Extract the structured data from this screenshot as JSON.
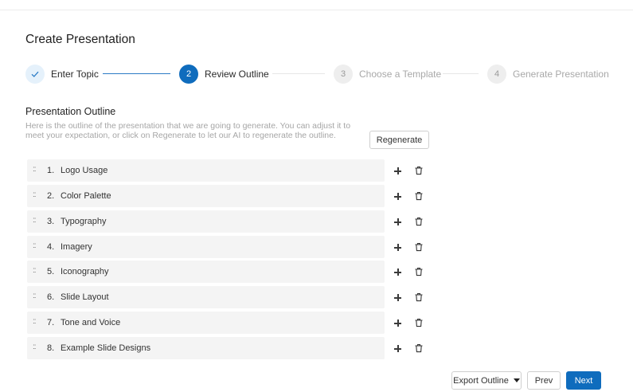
{
  "page": {
    "title": "Create Presentation"
  },
  "stepper": [
    {
      "number": "1",
      "label": "Enter Topic",
      "state": "done"
    },
    {
      "number": "2",
      "label": "Review Outline",
      "state": "active"
    },
    {
      "number": "3",
      "label": "Choose a Template",
      "state": "future"
    },
    {
      "number": "4",
      "label": "Generate Presentation",
      "state": "future"
    }
  ],
  "outline": {
    "title": "Presentation Outline",
    "description": "Here is the outline of the presentation that we are going to generate. You can adjust it to meet your expectation, or click on Regenerate to let our AI to regenerate the outline.",
    "regenerate_label": "Regenerate",
    "drag_glyph": "::",
    "items": [
      {
        "number": "1.",
        "label": "Logo Usage"
      },
      {
        "number": "2.",
        "label": "Color Palette"
      },
      {
        "number": "3.",
        "label": "Typography"
      },
      {
        "number": "4.",
        "label": "Imagery"
      },
      {
        "number": "5.",
        "label": "Iconography"
      },
      {
        "number": "6.",
        "label": "Slide Layout"
      },
      {
        "number": "7.",
        "label": "Tone and Voice"
      },
      {
        "number": "8.",
        "label": "Example Slide Designs"
      }
    ]
  },
  "footer": {
    "export_label": "Export Outline",
    "prev_label": "Prev",
    "next_label": "Next"
  },
  "colors": {
    "primary": "#0f6cbd",
    "row_bg": "#f4f4f4",
    "muted_text": "#a6a6a6"
  }
}
